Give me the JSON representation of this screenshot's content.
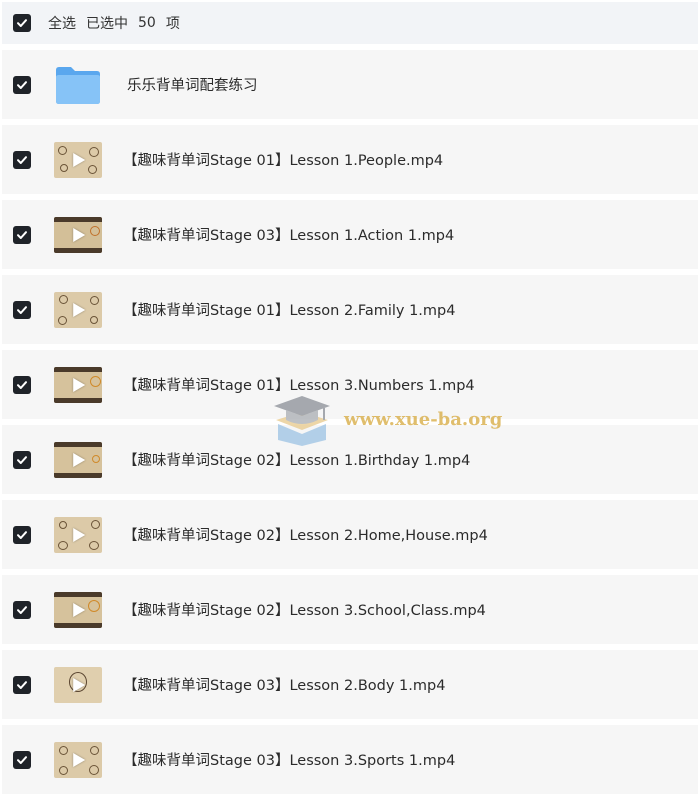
{
  "header": {
    "select_all_label": "全选",
    "selected_prefix": "已选中",
    "selected_count": "50",
    "selected_suffix": "项",
    "checked": true
  },
  "items": [
    {
      "type": "folder",
      "name": "乐乐背单词配套练习",
      "checked": true,
      "icon": "folder-icon"
    },
    {
      "type": "video",
      "name": "【趣味背单词Stage 01】Lesson 1.People.mp4",
      "checked": true,
      "icon": "video-thumbnail"
    },
    {
      "type": "video",
      "name": "【趣味背单词Stage 03】Lesson 1.Action 1.mp4",
      "checked": true,
      "icon": "video-thumbnail"
    },
    {
      "type": "video",
      "name": "【趣味背单词Stage 01】Lesson 2.Family 1.mp4",
      "checked": true,
      "icon": "video-thumbnail"
    },
    {
      "type": "video",
      "name": "【趣味背单词Stage 01】Lesson 3.Numbers 1.mp4",
      "checked": true,
      "icon": "video-thumbnail"
    },
    {
      "type": "video",
      "name": "【趣味背单词Stage 02】Lesson 1.Birthday 1.mp4",
      "checked": true,
      "icon": "video-thumbnail"
    },
    {
      "type": "video",
      "name": "【趣味背单词Stage 02】Lesson 2.Home,House.mp4",
      "checked": true,
      "icon": "video-thumbnail"
    },
    {
      "type": "video",
      "name": "【趣味背单词Stage 02】Lesson 3.School,Class.mp4",
      "checked": true,
      "icon": "video-thumbnail"
    },
    {
      "type": "video",
      "name": "【趣味背单词Stage 03】Lesson 2.Body 1.mp4",
      "checked": true,
      "icon": "video-thumbnail"
    },
    {
      "type": "video",
      "name": "【趣味背单词Stage 03】Lesson 3.Sports 1.mp4",
      "checked": true,
      "icon": "video-thumbnail"
    }
  ],
  "watermark": {
    "text": "www.xue-ba.org",
    "icon": "graduation-cap-logo"
  },
  "colors": {
    "checkbox": "#1f2329",
    "row_background": "#f6f6f6",
    "header_background": "#f2f4f7",
    "folder": "#6fb6f3",
    "watermark": "#d6a83c"
  }
}
